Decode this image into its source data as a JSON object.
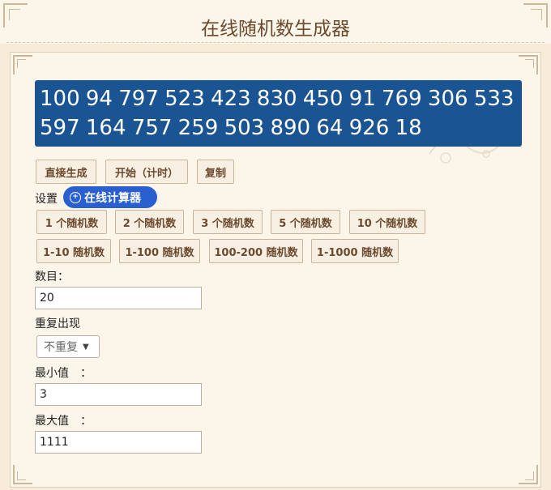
{
  "header": {
    "title": "在线随机数生成器"
  },
  "output": {
    "numbers": "100 94 797 523 423 830 450 91 769 306 533 597 164 757 259 503 890 64 926 18"
  },
  "actions": {
    "generate": "直接生成",
    "start_timed": "开始（计时）",
    "copy": "复制"
  },
  "settings": {
    "label": "设置",
    "calc_badge": "在线计算器",
    "presets_row1": [
      "1 个随机数",
      "2 个随机数",
      "3 个随机数",
      "5 个随机数",
      "10 个随机数"
    ],
    "presets_row2": [
      "1-10 随机数",
      "1-100 随机数",
      "100-200 随机数",
      "1-1000 随机数"
    ]
  },
  "form": {
    "count_label": "数目：",
    "count_value": "20",
    "repeat_label": "重复出现",
    "repeat_value": "不重复",
    "min_label": "最小值　：",
    "min_value": "3",
    "max_label": "最大值　：",
    "max_value": "1111"
  },
  "colors": {
    "accent": "#1b5492",
    "badge": "#2a5fd0",
    "background": "#f6ecd9"
  }
}
